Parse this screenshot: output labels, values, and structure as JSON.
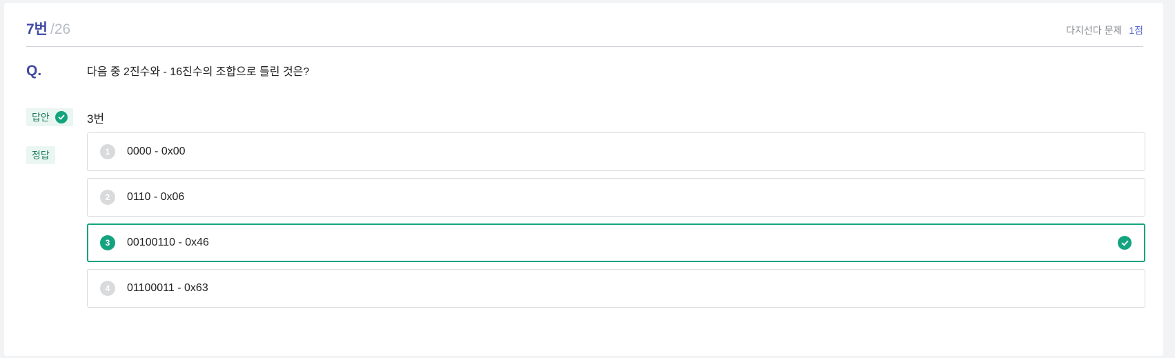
{
  "header": {
    "question_number": "7번",
    "total": "/26",
    "question_type": "다지선다 문제",
    "points": "1점"
  },
  "question": {
    "label": "Q.",
    "text": "다음 중 2진수와 - 16진수의 조합으로 틀린 것은?"
  },
  "answer": {
    "tag": "답안",
    "value": "3번"
  },
  "correct": {
    "tag": "정답"
  },
  "options": [
    {
      "num": "1",
      "text": "0000 - 0x00"
    },
    {
      "num": "2",
      "text": "0110 - 0x06"
    },
    {
      "num": "3",
      "text": "00100110 - 0x46"
    },
    {
      "num": "4",
      "text": "01100011 - 0x63"
    }
  ],
  "colors": {
    "accent": "#14a37f",
    "title": "#3f4aa3",
    "points": "#5a68d8"
  },
  "icons": {
    "answer_check": "check-circle-icon",
    "selected_check": "check-circle-icon"
  }
}
